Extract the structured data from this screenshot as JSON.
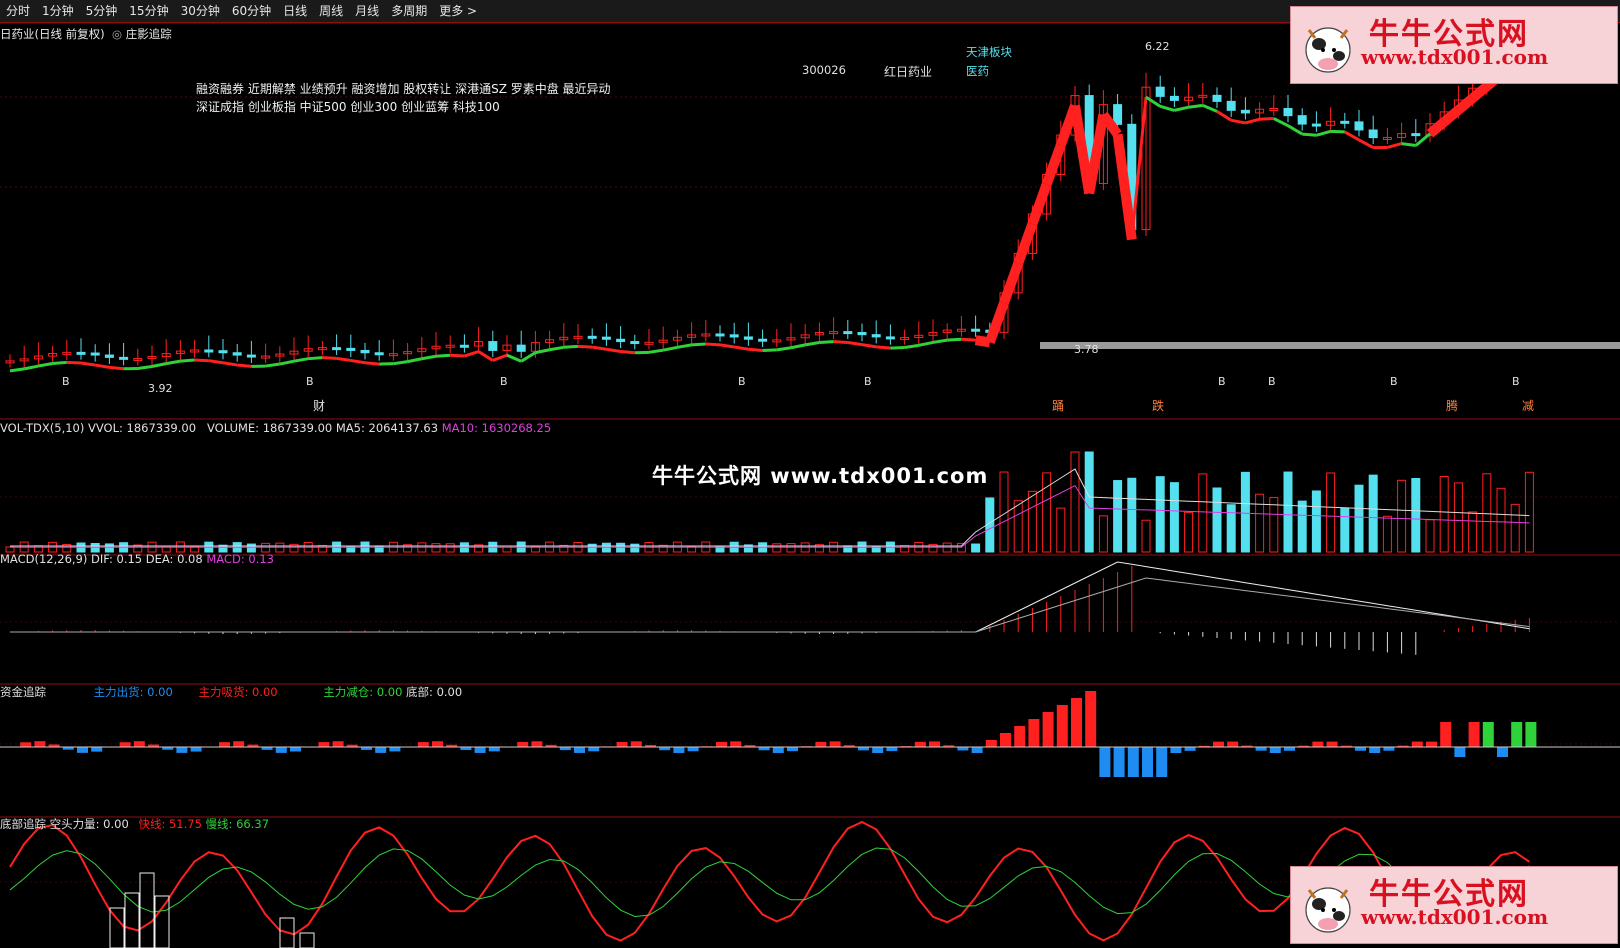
{
  "toolbar": {
    "items": [
      "分时",
      "1分钟",
      "5分钟",
      "15分钟",
      "30分钟",
      "60分钟",
      "日线",
      "周线",
      "月线",
      "多周期",
      "更多 >"
    ]
  },
  "main_panel": {
    "title": "日药业(日线 前复权)",
    "indicator": "庄影追踪",
    "concepts_line1": "融资融券 近期解禁 业绩预升 融资增加 股权转让 深港通SZ 罗素中盘 最近异动",
    "concepts_line2": "深证成指 创业板指 中证500 创业300 创业蓝筹 科技100",
    "stock_code": "300026",
    "stock_name": "红日药业",
    "block_label": "天津板块",
    "block_value": "医药",
    "high_label": "6.22",
    "low_label": "3.92",
    "mid_low_label": "3.78",
    "bottom_markers": [
      "财",
      "踊",
      "跌",
      "腾",
      "减"
    ],
    "b_marker": "B"
  },
  "volume_panel": {
    "prefix": "VOL-TDX(5,10)",
    "vvol": "VVOL: 1867339.00",
    "volume": "VOLUME: 1867339.00",
    "ma5": "MA5: 2064137.63",
    "ma10": "MA10: 1630268.25"
  },
  "macd_panel": {
    "prefix": "MACD(12,26,9)",
    "dif": "DIF: 0.15",
    "dea": "DEA: 0.08",
    "macd": "MACD: 0.13"
  },
  "fund_panel": {
    "title": "资金追踪",
    "out": "主力出货: 0.00",
    "absorb": "主力吸货: 0.00",
    "reduce": "主力减仓: 0.00",
    "bottom": "底部: 0.00"
  },
  "bottom_panel": {
    "title": "底部追踪",
    "short_power": "空头力量: 0.00",
    "fast": "快线: 51.75",
    "slow": "慢线: 66.37"
  },
  "watermark": {
    "text": "牛牛公式网 www.tdx001.com",
    "logo_cn": "牛牛公式网",
    "logo_url": "www.tdx001.com"
  },
  "colors": {
    "up": "#ff2020",
    "down": "#54e0ee",
    "green": "#2ed33a",
    "blue": "#1e8cf0",
    "magenta": "#e040e0",
    "panel_border": "#8b1010"
  }
}
